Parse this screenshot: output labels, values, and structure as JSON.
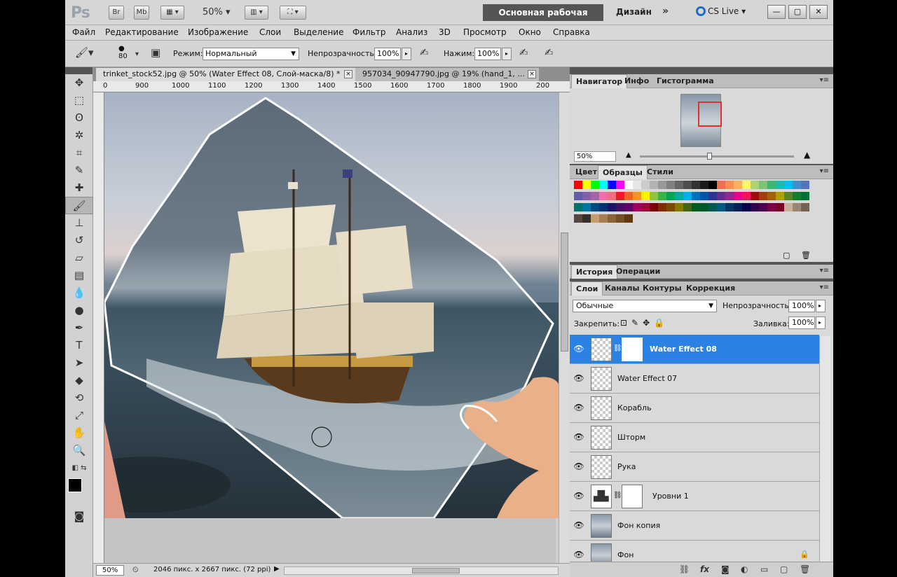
{
  "app": {
    "logo": "Ps",
    "mini_buttons": [
      "Br",
      "Mb"
    ],
    "zoom_level": "50%",
    "workspace_button": "Основная рабочая среда",
    "design_label": "Дизайн",
    "more_label": "»",
    "cslive_label": "CS Live",
    "window_buttons": [
      "—",
      "▢",
      "✕"
    ]
  },
  "menu": [
    "Файл",
    "Редактирование",
    "Изображение",
    "Слои",
    "Выделение",
    "Фильтр",
    "Анализ",
    "3D",
    "Просмотр",
    "Окно",
    "Справка"
  ],
  "options": {
    "brush_size": "80",
    "mode_label": "Режим:",
    "mode_value": "Нормальный",
    "opacity_label": "Непрозрачность:",
    "opacity_value": "100%",
    "flow_label": "Нажим:",
    "flow_value": "100%"
  },
  "tabs": [
    {
      "title": "trinket_stock52.jpg @ 50% (Water Effect 08, Слой-маска/8) *",
      "active": true
    },
    {
      "title": "957034_90947790.jpg @ 19% (hand_1, ...",
      "active": false
    }
  ],
  "ruler_ticks": [
    "0",
    "900",
    "1000",
    "1100",
    "1200",
    "1300",
    "1400",
    "1500",
    "1600",
    "1700",
    "1800",
    "1900",
    "200"
  ],
  "status": {
    "zoom": "50%",
    "doc_info": "2046 пикс. x 2667 пикс. (72 ppi)"
  },
  "navigator": {
    "tabs": [
      "Навигатор",
      "Инфо",
      "Гистограмма"
    ],
    "zoom": "50%"
  },
  "color_panel": {
    "tabs": [
      "Цвет",
      "Образцы",
      "Стили"
    ],
    "swatches": [
      "#ff0000",
      "#ffff00",
      "#00ff00",
      "#00ffff",
      "#0000ff",
      "#ff00ff",
      "#ffffff",
      "#e6e6e6",
      "#cccccc",
      "#b3b3b3",
      "#999999",
      "#808080",
      "#666666",
      "#4d4d4d",
      "#333333",
      "#1a1a1a",
      "#000000",
      "#f26c4f",
      "#f68e56",
      "#fbaf5d",
      "#fff568",
      "#acd373",
      "#7cc576",
      "#3bb878",
      "#1abbb4",
      "#00bff3",
      "#448ccb",
      "#5674b9",
      "#605ca8",
      "#855fa8",
      "#a864a8",
      "#f06eaa",
      "#f26d7d",
      "#ed1c24",
      "#f26522",
      "#f7941d",
      "#fff200",
      "#8dc63f",
      "#39b54a",
      "#00a651",
      "#00a99d",
      "#00aeef",
      "#0072bc",
      "#0054a6",
      "#2e3192",
      "#662d91",
      "#92278f",
      "#ec008c",
      "#ed145b",
      "#9e0b0f",
      "#a0410d",
      "#a36209",
      "#aba000",
      "#598527",
      "#197b30",
      "#007236",
      "#00746b",
      "#0076a3",
      "#004a80",
      "#003471",
      "#1b1464",
      "#440e62",
      "#630460",
      "#9e005d",
      "#9e0039",
      "#790000",
      "#7b2e00",
      "#7d4900",
      "#827b00",
      "#406618",
      "#005e20",
      "#005826",
      "#005952",
      "#005b7f",
      "#003663",
      "#002157",
      "#0d004c",
      "#32004b",
      "#4b0049",
      "#7b0046",
      "#7a0026",
      "#c7b299",
      "#998675",
      "#736357",
      "#534741",
      "#37302a",
      "#c69c6d",
      "#a67c52",
      "#8c6239",
      "#754c24",
      "#603913"
    ]
  },
  "history_panel": {
    "tabs": [
      "История",
      "Операции"
    ]
  },
  "layers_panel": {
    "tabs": [
      "Слои",
      "Каналы",
      "Контуры",
      "Коррекция"
    ],
    "blend_mode": "Обычные",
    "opacity_label": "Непрозрачность:",
    "opacity_value": "100%",
    "lock_label": "Закрепить:",
    "fill_label": "Заливка:",
    "fill_value": "100%",
    "layers": [
      {
        "name": "Water Effect 08",
        "selected": true,
        "has_mask": true
      },
      {
        "name": "Water Effect 07",
        "selected": false,
        "has_mask": false
      },
      {
        "name": "Корабль",
        "selected": false,
        "has_mask": false
      },
      {
        "name": "Шторм",
        "selected": false,
        "has_mask": false
      },
      {
        "name": "Рука",
        "selected": false,
        "has_mask": false
      },
      {
        "name": "Уровни 1",
        "selected": false,
        "has_mask": true
      },
      {
        "name": "Фон копия",
        "selected": false,
        "has_mask": false
      },
      {
        "name": "Фон",
        "selected": false,
        "has_mask": false,
        "locked": true
      }
    ],
    "footer_icons": [
      "link-icon",
      "fx-icon",
      "mask-icon",
      "adjustment-icon",
      "folder-icon",
      "new-layer-icon",
      "trash-icon"
    ]
  }
}
